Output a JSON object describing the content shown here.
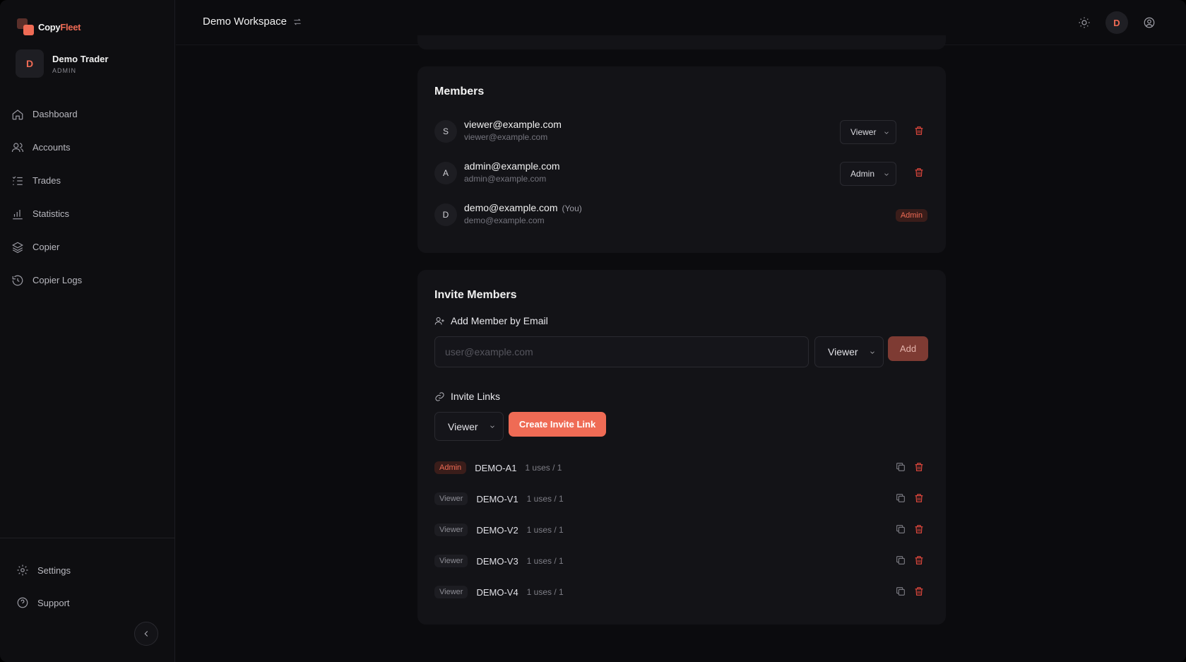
{
  "app": {
    "logo_part1": "Copy",
    "logo_part2": "Fleet"
  },
  "user": {
    "initial": "D",
    "name": "Demo Trader",
    "role": "ADMIN"
  },
  "nav": [
    {
      "label": "Dashboard",
      "icon": "home-icon"
    },
    {
      "label": "Accounts",
      "icon": "users-icon"
    },
    {
      "label": "Trades",
      "icon": "list-icon"
    },
    {
      "label": "Statistics",
      "icon": "bar-chart-icon"
    },
    {
      "label": "Copier",
      "icon": "layers-icon"
    },
    {
      "label": "Copier Logs",
      "icon": "history-icon"
    }
  ],
  "bottom_nav": [
    {
      "label": "Settings",
      "icon": "gear-icon"
    },
    {
      "label": "Support",
      "icon": "help-icon"
    }
  ],
  "topbar": {
    "workspace": "Demo Workspace",
    "avatar_initial": "D"
  },
  "members": {
    "title": "Members",
    "items": [
      {
        "initial": "S",
        "email": "viewer@example.com",
        "sub": "viewer@example.com",
        "role": "Viewer",
        "you": ""
      },
      {
        "initial": "A",
        "email": "admin@example.com",
        "sub": "admin@example.com",
        "role": "Admin",
        "you": ""
      },
      {
        "initial": "D",
        "email": "demo@example.com",
        "sub": "demo@example.com",
        "role": "Admin",
        "you": "(You)"
      }
    ]
  },
  "invite": {
    "title": "Invite Members",
    "add_by_email": "Add Member by Email",
    "email_placeholder": "user@example.com",
    "email_role": "Viewer",
    "add_label": "Add",
    "links_title": "Invite Links",
    "link_role": "Viewer",
    "create_label": "Create Invite Link",
    "links": [
      {
        "role": "Admin",
        "code": "DEMO-A1",
        "uses": "1 uses / 1"
      },
      {
        "role": "Viewer",
        "code": "DEMO-V1",
        "uses": "1 uses / 1"
      },
      {
        "role": "Viewer",
        "code": "DEMO-V2",
        "uses": "1 uses / 1"
      },
      {
        "role": "Viewer",
        "code": "DEMO-V3",
        "uses": "1 uses / 1"
      },
      {
        "role": "Viewer",
        "code": "DEMO-V4",
        "uses": "1 uses / 1"
      }
    ]
  },
  "colors": {
    "accent": "#ef6b55",
    "danger": "#e2483d",
    "background": "#0b0b0e",
    "card": "#131317"
  }
}
